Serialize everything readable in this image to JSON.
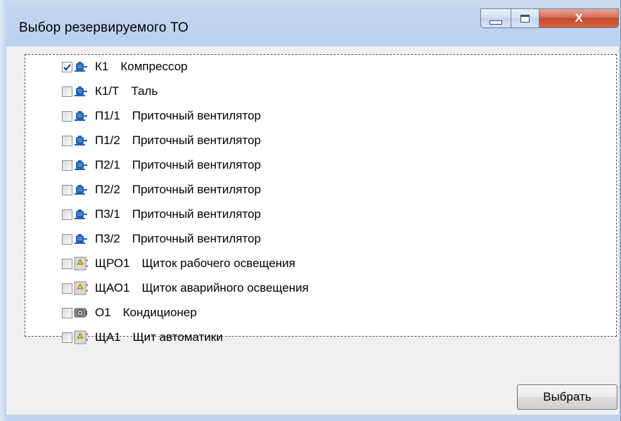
{
  "window": {
    "title": "Выбор резервируемого ТО",
    "close_glyph": "X"
  },
  "tree": {
    "items": [
      {
        "checked": true,
        "icon": "motor-icon",
        "code": "К1",
        "name": "Компрессор"
      },
      {
        "checked": false,
        "icon": "motor-icon",
        "code": "К1/Т",
        "name": "Таль"
      },
      {
        "checked": false,
        "icon": "motor-icon",
        "code": "П1/1",
        "name": "Приточный вентилятор"
      },
      {
        "checked": false,
        "icon": "motor-icon",
        "code": "П1/2",
        "name": "Приточный вентилятор"
      },
      {
        "checked": false,
        "icon": "motor-icon",
        "code": "П2/1",
        "name": "Приточный вентилятор"
      },
      {
        "checked": false,
        "icon": "motor-icon",
        "code": "П2/2",
        "name": "Приточный вентилятор"
      },
      {
        "checked": false,
        "icon": "motor-icon",
        "code": "П3/1",
        "name": "Приточный вентилятор"
      },
      {
        "checked": false,
        "icon": "motor-icon",
        "code": "П3/2",
        "name": "Приточный вентилятор"
      },
      {
        "checked": false,
        "icon": "panel-icon",
        "code": "ЩРО1",
        "name": "Щиток рабочего освещения"
      },
      {
        "checked": false,
        "icon": "panel-icon",
        "code": "ЩАО1",
        "name": "Щиток аварийного освещения"
      },
      {
        "checked": false,
        "icon": "air-conditioner-icon",
        "code": "О1",
        "name": "Кондиционер"
      },
      {
        "checked": false,
        "icon": "panel-icon",
        "code": "ЩА1",
        "name": "Щит автоматики"
      }
    ]
  },
  "footer": {
    "select_label": "Выбрать"
  },
  "colors": {
    "motor": "#1f5fb4",
    "panel": "#d9d9d9",
    "check": "#1c2c7a"
  }
}
